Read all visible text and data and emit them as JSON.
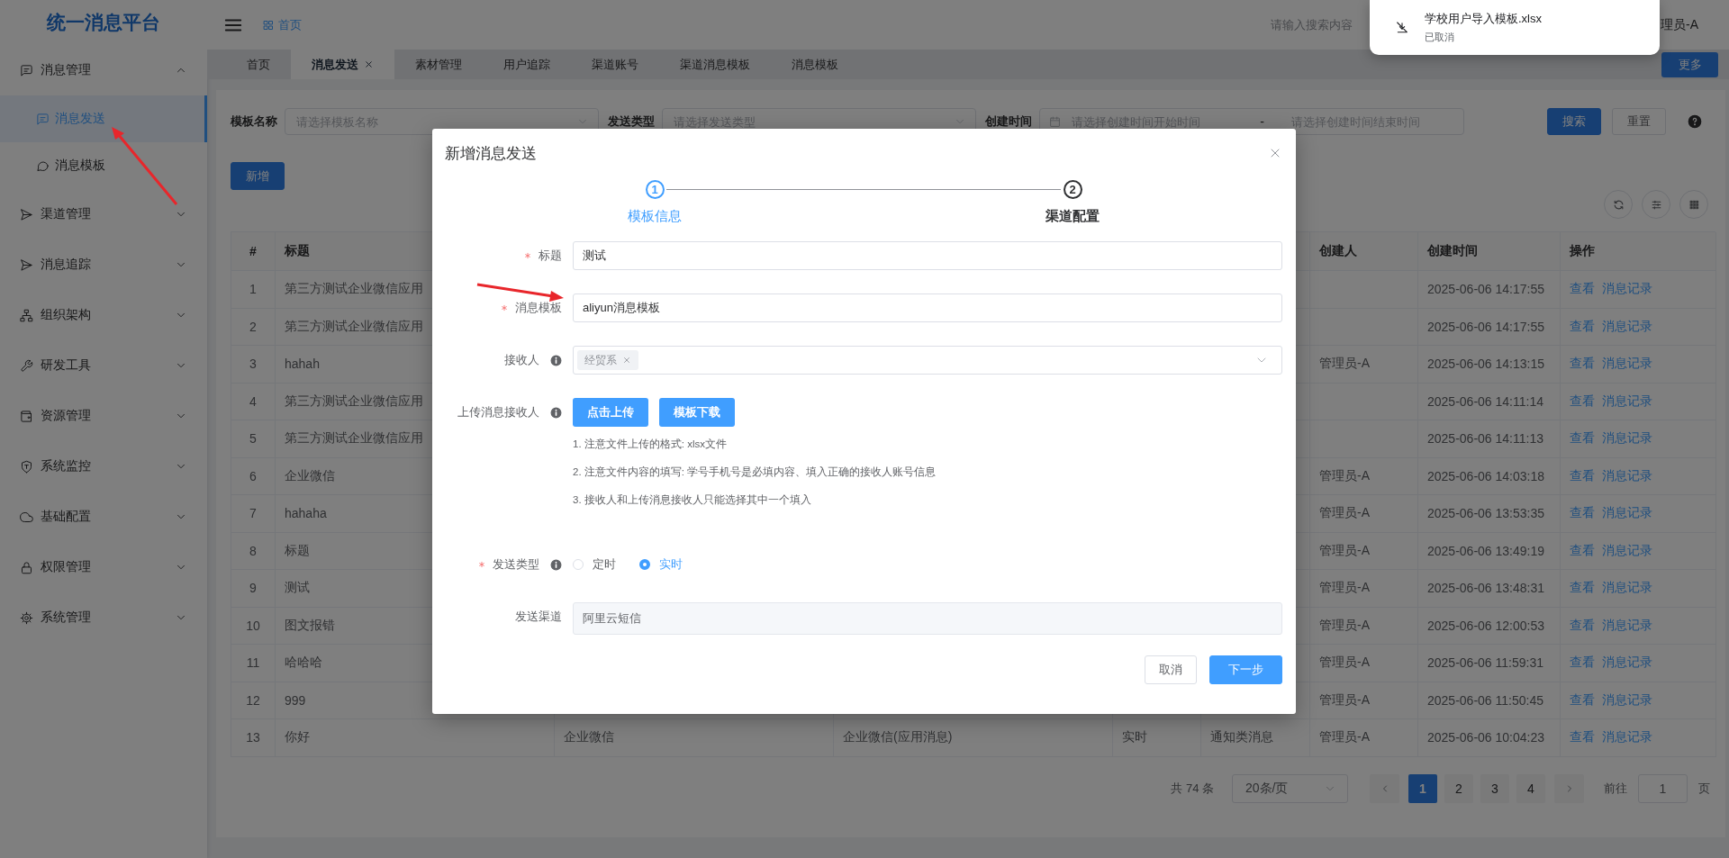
{
  "app_title": "统一消息平台",
  "sidebar": {
    "items": [
      {
        "label": "消息管理",
        "selected": false,
        "expanded": true,
        "children": [
          {
            "label": "消息发送",
            "selected": true
          },
          {
            "label": "消息模板",
            "selected": false
          }
        ]
      },
      {
        "label": "渠道管理",
        "selected": false,
        "expanded": false
      },
      {
        "label": "消息追踪",
        "selected": false,
        "expanded": false
      },
      {
        "label": "组织架构",
        "selected": false,
        "expanded": false
      },
      {
        "label": "研发工具",
        "selected": false,
        "expanded": false
      },
      {
        "label": "资源管理",
        "selected": false,
        "expanded": false
      },
      {
        "label": "系统监控",
        "selected": false,
        "expanded": false
      },
      {
        "label": "基础配置",
        "selected": false,
        "expanded": false
      },
      {
        "label": "权限管理",
        "selected": false,
        "expanded": false
      },
      {
        "label": "系统管理",
        "selected": false,
        "expanded": false
      }
    ]
  },
  "header": {
    "breadcrumb": "首页",
    "search": {
      "placeholder": "请输入搜索内容"
    },
    "user": "理员-A"
  },
  "download_notice": {
    "file_name": "学校用户导入模板.xlsx",
    "status": "已取消"
  },
  "tabs": [
    {
      "label": "首页",
      "selected": false,
      "closable": false
    },
    {
      "label": "消息发送",
      "selected": true,
      "closable": true
    },
    {
      "label": "素材管理",
      "selected": false,
      "closable": false
    },
    {
      "label": "用户追踪",
      "selected": false,
      "closable": false
    },
    {
      "label": "渠道账号",
      "selected": false,
      "closable": false
    },
    {
      "label": "渠道消息模板",
      "selected": false,
      "closable": false
    },
    {
      "label": "消息模板",
      "selected": false,
      "closable": false
    }
  ],
  "more_button": "更多",
  "filters": [
    {
      "kind": "select",
      "label": "模板名称",
      "placeholder": "请选择模板名称"
    },
    {
      "kind": "select",
      "label": "发送类型",
      "placeholder": "请选择发送类型"
    },
    {
      "kind": "daterange",
      "label": "创建时间",
      "start_placeholder": "请选择创建时间开始时间",
      "separator": "-",
      "end_placeholder": "请选择创建时间结束时间"
    }
  ],
  "filter_buttons": [
    {
      "label": "搜索",
      "kind": "primary"
    },
    {
      "label": "重置",
      "kind": "default"
    }
  ],
  "add_button": "新增",
  "table": {
    "columns": [
      "#",
      "标题",
      null,
      null,
      null,
      null,
      "创建人",
      "创建时间",
      "操作"
    ],
    "rows": [
      {
        "cells": [
          "1",
          "第三方测试企业微信应用",
          null,
          null,
          null,
          null,
          null,
          "2025-06-06 14:17:55"
        ],
        "actions": [
          "查看",
          "消息记录"
        ]
      },
      {
        "cells": [
          "2",
          "第三方测试企业微信应用",
          null,
          null,
          null,
          null,
          null,
          "2025-06-06 14:17:55"
        ],
        "actions": [
          "查看",
          "消息记录"
        ]
      },
      {
        "cells": [
          "3",
          "hahah",
          null,
          null,
          null,
          null,
          "管理员-A",
          "2025-06-06 14:13:15"
        ],
        "actions": [
          "查看",
          "消息记录"
        ]
      },
      {
        "cells": [
          "4",
          "第三方测试企业微信应用",
          null,
          null,
          null,
          null,
          null,
          "2025-06-06 14:11:14"
        ],
        "actions": [
          "查看",
          "消息记录"
        ]
      },
      {
        "cells": [
          "5",
          "第三方测试企业微信应用",
          null,
          null,
          null,
          null,
          null,
          "2025-06-06 14:11:13"
        ],
        "actions": [
          "查看",
          "消息记录"
        ]
      },
      {
        "cells": [
          "6",
          "企业微信",
          null,
          null,
          null,
          null,
          "管理员-A",
          "2025-06-06 14:03:18"
        ],
        "actions": [
          "查看",
          "消息记录"
        ]
      },
      {
        "cells": [
          "7",
          "hahaha",
          null,
          null,
          null,
          null,
          "管理员-A",
          "2025-06-06 13:53:35"
        ],
        "actions": [
          "查看",
          "消息记录"
        ]
      },
      {
        "cells": [
          "8",
          "标题",
          null,
          null,
          null,
          null,
          "管理员-A",
          "2025-06-06 13:49:19"
        ],
        "actions": [
          "查看",
          "消息记录"
        ]
      },
      {
        "cells": [
          "9",
          "测试",
          null,
          null,
          null,
          null,
          "管理员-A",
          "2025-06-06 13:48:31"
        ],
        "actions": [
          "查看",
          "消息记录"
        ]
      },
      {
        "cells": [
          "10",
          "图文报错",
          null,
          null,
          null,
          null,
          "管理员-A",
          "2025-06-06 12:00:53"
        ],
        "actions": [
          "查看",
          "消息记录"
        ]
      },
      {
        "cells": [
          "11",
          "哈哈哈",
          null,
          null,
          null,
          null,
          "管理员-A",
          "2025-06-06 11:59:31"
        ],
        "actions": [
          "查看",
          "消息记录"
        ]
      },
      {
        "cells": [
          "12",
          "999",
          null,
          null,
          null,
          null,
          "管理员-A",
          "2025-06-06 11:50:45"
        ],
        "actions": [
          "查看",
          "消息记录"
        ]
      },
      {
        "cells": [
          "13",
          "你好",
          "企业微信",
          "企业微信(应用消息)",
          "实时",
          "通知类消息",
          "管理员-A",
          "2025-06-06 10:04:23"
        ],
        "actions": [
          "查看",
          "消息记录"
        ]
      }
    ]
  },
  "pagination": {
    "total": "共 74 条",
    "page_size": "20条/页",
    "pages": [
      {
        "label": "1",
        "selected": true
      },
      {
        "label": "2",
        "selected": false
      },
      {
        "label": "3",
        "selected": false
      },
      {
        "label": "4",
        "selected": false
      }
    ],
    "goto_label": "前往",
    "goto_value": "1",
    "page_unit": "页"
  },
  "dialog": {
    "title": "新增消息发送",
    "steps": [
      {
        "number": "1",
        "label": "模板信息",
        "selected": true
      },
      {
        "number": "2",
        "label": "渠道配置",
        "selected": false
      }
    ],
    "fields": [
      {
        "kind": "text",
        "label": "标题",
        "required": true,
        "info": false,
        "value": "测试"
      },
      {
        "kind": "text",
        "label": "消息模板",
        "required": true,
        "info": false,
        "value": "aliyun消息模板"
      },
      {
        "kind": "tags",
        "label": "接收人",
        "required": false,
        "info": true,
        "tags": [
          "经贸系"
        ]
      },
      {
        "kind": "upload",
        "label": "上传消息接收人",
        "required": false,
        "info": true,
        "buttons": [
          "点击上传",
          "模板下载"
        ],
        "hints": [
          "1. 注意文件上传的格式: xlsx文件",
          "2. 注意文件内容的填写: 学号手机号是必填内容、填入正确的接收人账号信息",
          "3. 接收人和上传消息接收人只能选择其中一个填入"
        ]
      },
      {
        "kind": "radio",
        "label": "发送类型",
        "required": true,
        "info": true,
        "options": [
          {
            "label": "定时",
            "selected": false
          },
          {
            "label": "实时",
            "selected": true
          }
        ]
      },
      {
        "kind": "readonly",
        "label": "发送渠道",
        "required": false,
        "info": false,
        "value": "阿里云短信"
      }
    ],
    "buttons": [
      {
        "label": "取消",
        "kind": "default"
      },
      {
        "label": "下一步",
        "kind": "primary"
      }
    ]
  }
}
